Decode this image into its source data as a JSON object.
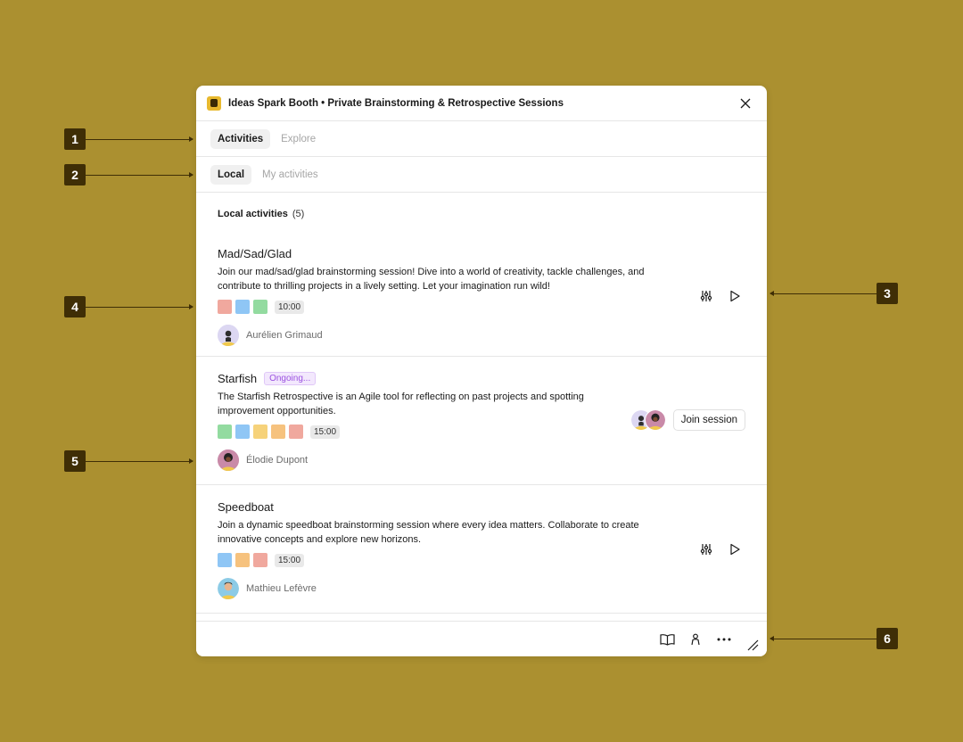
{
  "window": {
    "title": "Ideas Spark Booth • Private Brainstorming & Retrospective Sessions"
  },
  "tabs": [
    {
      "label": "Activities",
      "active": true
    },
    {
      "label": "Explore",
      "active": false
    }
  ],
  "subtabs": [
    {
      "label": "Local",
      "active": true
    },
    {
      "label": "My activities",
      "active": false
    }
  ],
  "section": {
    "label": "Local activities",
    "count": "(5)"
  },
  "activities": [
    {
      "title": "Mad/Sad/Glad",
      "description": "Join our mad/sad/glad brainstorming session! Dive into a world of creativity, tackle challenges, and contribute to thrilling projects in a lively setting. Let your imagination run wild!",
      "colors": [
        "#f0a89e",
        "#8fc6f5",
        "#93dba0"
      ],
      "time": "10:00",
      "owner": "Aurélien Grimaud",
      "actions": [
        "settings-icon",
        "play-icon"
      ]
    },
    {
      "title": "Starfish",
      "badge": "Ongoing...",
      "description": "The Starfish Retrospective is an Agile tool for reflecting on past projects and spotting improvement opportunities.",
      "colors": [
        "#93dba0",
        "#8fc6f5",
        "#f6d27a",
        "#f6c27e",
        "#f0a89e"
      ],
      "time": "15:00",
      "owner": "Élodie Dupont",
      "join_label": "Join session"
    },
    {
      "title": "Speedboat",
      "description": "Join a dynamic speedboat brainstorming session where every idea matters. Collaborate to create innovative concepts and explore new horizons.",
      "colors": [
        "#8fc6f5",
        "#f6c27e",
        "#f0a89e"
      ],
      "time": "15:00",
      "owner": "Mathieu Lefèvre",
      "actions": [
        "settings-icon",
        "play-icon"
      ]
    }
  ],
  "footer": {
    "icons": [
      "book-icon",
      "person-icon",
      "more-icon",
      "resize-handle-icon"
    ]
  },
  "callouts": [
    "1",
    "2",
    "3",
    "4",
    "5",
    "6"
  ],
  "colors": {
    "background": "#ab9030",
    "callout": "#3f2e06",
    "badge": "#9b51e0"
  }
}
